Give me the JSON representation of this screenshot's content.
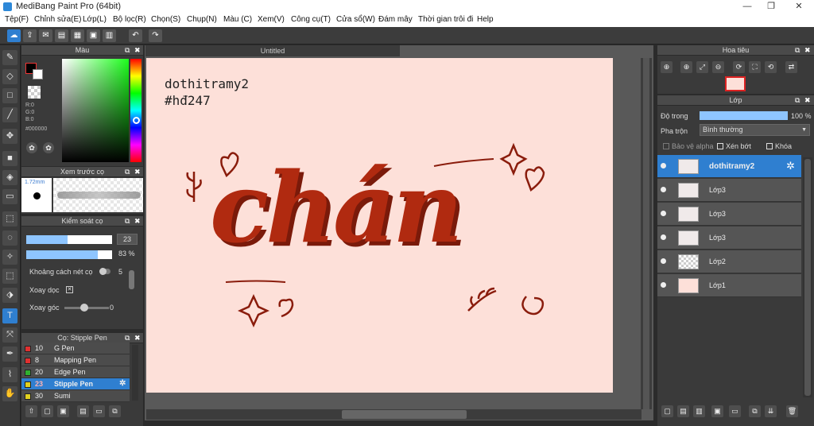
{
  "window": {
    "title": "MediBang Paint Pro (64bit)"
  },
  "menu": [
    "Tệp(F)",
    "Chỉnh sửa(E)",
    "Lớp(L)",
    "Bộ lọc(R)",
    "Chọn(S)",
    "Chụp(N)",
    "Màu (C)",
    "Xem(V)",
    "Công cụ(T)",
    "Cửa sổ(W)",
    "Đám mây",
    "Thời gian trôi đi",
    "Help"
  ],
  "panels": {
    "color": {
      "title": "Màu",
      "r": "R:0",
      "g": "G:0",
      "b": "B:0",
      "hex": "#000000"
    },
    "brush_preview": {
      "title": "Xem trước cọ",
      "size": "1.72mm"
    },
    "brush_control": {
      "title": "Kiểm soát cọ",
      "size_value": "23",
      "opacity_value": "83 %",
      "opacity_level": 0.83,
      "spacing_label": "Khoảng cách nét cọ",
      "spacing_value": "5",
      "rotate_label": "Xoay dọc",
      "angle_label": "Xoay góc",
      "angle_value": "0"
    },
    "brush_list": {
      "title": "Cọ: Stipple Pen",
      "items": [
        {
          "size": "10",
          "name": "G Pen",
          "color": "#e03030"
        },
        {
          "size": "8",
          "name": "Mapping Pen",
          "color": "#e03030"
        },
        {
          "size": "20",
          "name": "Edge Pen",
          "color": "#30b030"
        },
        {
          "size": "23",
          "name": "Stipple Pen",
          "color": "#e0d020"
        },
        {
          "size": "30",
          "name": "Sumi",
          "color": "#e0d020"
        }
      ]
    },
    "navigator": {
      "title": "Hoa tiêu"
    },
    "layers": {
      "title": "Lớp",
      "opacity_label": "Độ trong",
      "opacity_value": "100 %",
      "opacity_level": 1.0,
      "blend_label": "Pha trộn",
      "blend_value": "Bình thường",
      "protect_alpha": "Bảo vệ alpha",
      "clipping": "Xén bớt",
      "lock": "Khóa",
      "items": [
        {
          "name": "dothitramy2",
          "selected": true
        },
        {
          "name": "Lớp3",
          "selected": false
        },
        {
          "name": "Lớp3",
          "selected": false
        },
        {
          "name": "Lớp3",
          "selected": false
        },
        {
          "name": "Lớp2",
          "selected": false
        },
        {
          "name": "Lớp1",
          "selected": false
        }
      ]
    }
  },
  "document": {
    "tab_title": "Untitled",
    "text_line1": "dothitramy2",
    "text_line2": "#hđ247",
    "lettering": "chán",
    "accent_color": "#b02a10",
    "background_color": "#fde0d9"
  },
  "colors": {
    "accent": "#2f7fd0",
    "panel": "#3a3a3a"
  }
}
